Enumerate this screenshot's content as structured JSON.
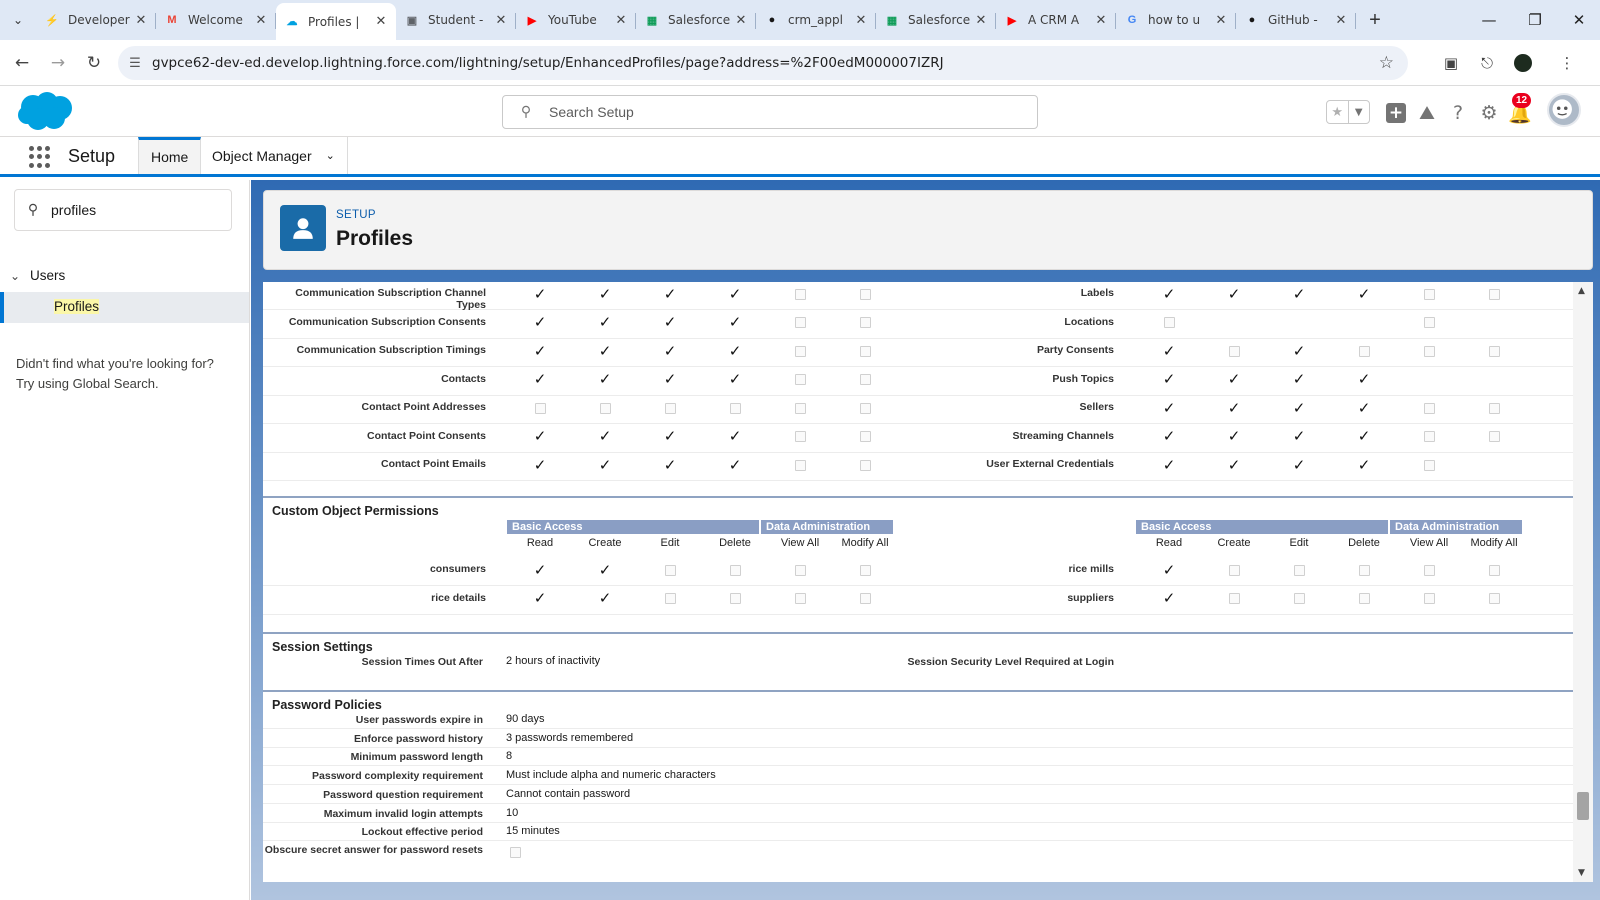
{
  "browser": {
    "tabs": [
      {
        "title": "Developer",
        "icon": "bolt-icon",
        "color": "#0176d3"
      },
      {
        "title": "Welcome",
        "icon": "gmail-icon",
        "color": "#ea4335"
      },
      {
        "title": "Profiles |",
        "icon": "salesforce-icon",
        "color": "#00a1e0",
        "active": true
      },
      {
        "title": "Student -",
        "icon": "image-icon",
        "color": "#5f6368"
      },
      {
        "title": "YouTube",
        "icon": "youtube-icon",
        "color": "#ff0000"
      },
      {
        "title": "Salesforce",
        "icon": "sheets-icon",
        "color": "#0f9d58"
      },
      {
        "title": "crm_appl",
        "icon": "github-icon",
        "color": "#181717"
      },
      {
        "title": "Salesforce",
        "icon": "sheets-icon",
        "color": "#0f9d58"
      },
      {
        "title": "A CRM A",
        "icon": "youtube-icon",
        "color": "#ff0000"
      },
      {
        "title": "how to u",
        "icon": "google-icon",
        "color": "#4285f4"
      },
      {
        "title": "GitHub -",
        "icon": "github-icon",
        "color": "#181717"
      }
    ],
    "url": "gvpce62-dev-ed.develop.lightning.force.com/lightning/setup/EnhancedProfiles/page?address=%2F00edM000007IZRJ"
  },
  "header": {
    "search_placeholder": "Search Setup",
    "notification_count": "12",
    "brand_color": "#00a1e0"
  },
  "nav": {
    "app_name": "Setup",
    "items": [
      "Home",
      "Object Manager"
    ]
  },
  "sidebar": {
    "quick_find_value": "profiles",
    "tree_parent": "Users",
    "tree_child": "Profiles",
    "not_found_line1": "Didn't find what you're looking for?",
    "not_found_line2": "Try using Global Search."
  },
  "page": {
    "breadcrumb": "SETUP",
    "title": "Profiles"
  },
  "standard_objects": {
    "left": [
      {
        "name": "Communication Subscription Channel Types",
        "perms": [
          1,
          1,
          1,
          1,
          0,
          0
        ]
      },
      {
        "name": "Communication Subscription Consents",
        "perms": [
          1,
          1,
          1,
          1,
          0,
          0
        ]
      },
      {
        "name": "Communication Subscription Timings",
        "perms": [
          1,
          1,
          1,
          1,
          0,
          0
        ]
      },
      {
        "name": "Contacts",
        "perms": [
          1,
          1,
          1,
          1,
          0,
          0
        ]
      },
      {
        "name": "Contact Point Addresses",
        "perms": [
          0,
          0,
          0,
          0,
          0,
          0
        ]
      },
      {
        "name": "Contact Point Consents",
        "perms": [
          1,
          1,
          1,
          1,
          0,
          0
        ]
      },
      {
        "name": "Contact Point Emails",
        "perms": [
          1,
          1,
          1,
          1,
          0,
          0
        ]
      }
    ],
    "right": [
      {
        "name": "Labels",
        "perms": [
          1,
          1,
          1,
          1,
          0,
          0
        ]
      },
      {
        "name": "Locations",
        "perms": [
          0,
          null,
          null,
          null,
          0,
          null
        ]
      },
      {
        "name": "Party Consents",
        "perms": [
          1,
          0,
          1,
          0,
          0,
          0
        ]
      },
      {
        "name": "Push Topics",
        "perms": [
          1,
          1,
          1,
          1,
          null,
          null
        ]
      },
      {
        "name": "Sellers",
        "perms": [
          1,
          1,
          1,
          1,
          0,
          0
        ]
      },
      {
        "name": "Streaming Channels",
        "perms": [
          1,
          1,
          1,
          1,
          0,
          0
        ]
      },
      {
        "name": "User External Credentials",
        "perms": [
          1,
          1,
          1,
          1,
          0,
          null
        ]
      }
    ]
  },
  "custom_objects": {
    "section_title": "Custom Object Permissions",
    "group_basic": "Basic Access",
    "group_admin": "Data Administration",
    "columns": [
      "Read",
      "Create",
      "Edit",
      "Delete",
      "View All",
      "Modify All"
    ],
    "left": [
      {
        "name": "consumers",
        "perms": [
          1,
          1,
          0,
          0,
          0,
          0
        ]
      },
      {
        "name": "rice details",
        "perms": [
          1,
          1,
          0,
          0,
          0,
          0
        ]
      }
    ],
    "right": [
      {
        "name": "rice mills",
        "perms": [
          1,
          0,
          0,
          0,
          0,
          0
        ]
      },
      {
        "name": "suppliers",
        "perms": [
          1,
          0,
          0,
          0,
          0,
          0
        ]
      }
    ]
  },
  "session": {
    "section_title": "Session Settings",
    "timeout_label": "Session Times Out After",
    "timeout_value": "2 hours of inactivity",
    "security_label": "Session Security Level Required at Login"
  },
  "password": {
    "section_title": "Password Policies",
    "rows": [
      {
        "label": "User passwords expire in",
        "value": "90 days"
      },
      {
        "label": "Enforce password history",
        "value": "3 passwords remembered"
      },
      {
        "label": "Minimum password length",
        "value": "8"
      },
      {
        "label": "Password complexity requirement",
        "value": "Must include alpha and numeric characters"
      },
      {
        "label": "Password question requirement",
        "value": "Cannot contain password"
      },
      {
        "label": "Maximum invalid login attempts",
        "value": "10"
      },
      {
        "label": "Lockout effective period",
        "value": "15 minutes"
      }
    ],
    "obscure_label": "Obscure secret answer for password resets"
  }
}
